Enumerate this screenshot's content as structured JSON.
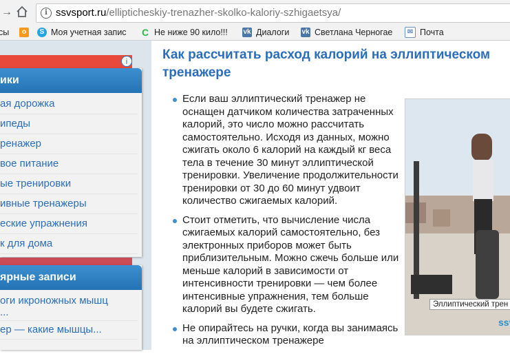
{
  "browser": {
    "url_domain": "ssvsport.ru",
    "url_path": "/ellipticheskiy-trenazher-skolko-kaloriy-szhigaetsya/"
  },
  "bookmarks": [
    {
      "label": "сы",
      "icon": "bookmark-folder-icon"
    },
    {
      "label": "",
      "icon": "odnoklassniki-icon"
    },
    {
      "label": "Моя учетная запис",
      "icon": "skype-icon"
    },
    {
      "label": "Не ниже 90 кило!!!",
      "icon": "c-green-icon"
    },
    {
      "label": "Диалоги",
      "icon": "vk-icon"
    },
    {
      "label": "Светлана Черногае",
      "icon": "vk-icon"
    },
    {
      "label": "Почта",
      "icon": "mail-icon"
    }
  ],
  "sidebar": {
    "widget1": {
      "header": "ики",
      "items": [
        "ая дорожка",
        "ипеды",
        "ренажер",
        "вое питание",
        "ые тренировки",
        "ивные тренажеры",
        "еские упражнения",
        "к для дома"
      ]
    },
    "widget2": {
      "header": "ярные записи",
      "items": [
        "оги икроножных мышц",
        "...",
        "ер — какие мышцы..."
      ]
    }
  },
  "article": {
    "title": "Как рассчитать расход калорий на эллиптическом тренажере",
    "bullets": [
      "Если ваш эллиптический тренажер не оснащен датчиком количества затраченных калорий, это число можно рассчитать самостоятельно. Исходя из данных, можно сжигать около 6 калорий на каждый кг веса тела в течение 30 минут эллиптической тренировки. Увеличение продолжительности тренировки от 30 до 60 минут удвоит количество сжигаемых калорий.",
      "Стоит отметить, что вычисление числа сжигаемых калорий самостоятельно, без электронных приборов может быть приблизительным. Можно сжечь больше или меньше калорий в зависимости от интенсивности тренировки — чем более интенсивные упражнения, тем больше калорий вы будете сжигать.",
      "Не опирайтесь на ручки, когда вы занимаясь на эллиптическом тренажере"
    ],
    "photo_caption": "Эллиптический трен",
    "photo_brand": "ssv"
  }
}
